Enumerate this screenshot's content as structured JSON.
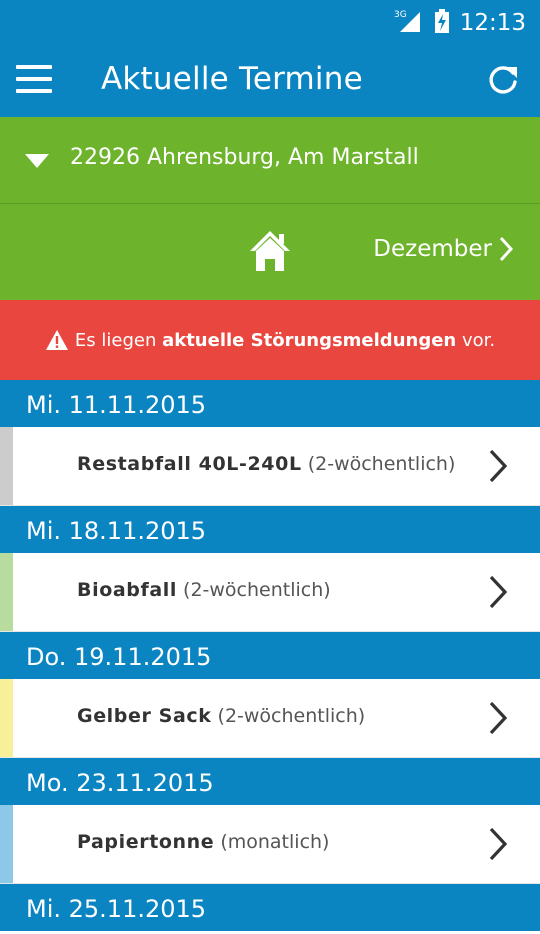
{
  "status": {
    "network": "3G",
    "time": "12:13"
  },
  "appbar": {
    "title": "Aktuelle Termine",
    "menu_icon": "menu-icon",
    "refresh_icon": "refresh-icon"
  },
  "address": {
    "text": "22926 Ahrensburg, Am Marstall"
  },
  "month_nav": {
    "next_label": "Dezember"
  },
  "alert": {
    "prefix": "Es liegen ",
    "bold": "aktuelle Störungsmeldungen",
    "suffix": " vor."
  },
  "colors": {
    "primary": "#0a85c2",
    "green": "#6db32b",
    "alert": "#e8463e"
  },
  "entries": [
    {
      "date": "Mi. 11.11.2015",
      "name": "Restabfall 40L-240L",
      "freq": "(2-wöchentlich)",
      "color": "#cccccc"
    },
    {
      "date": "Mi. 18.11.2015",
      "name": "Bioabfall",
      "freq": "(2-wöchentlich)",
      "color": "#b8dc9e"
    },
    {
      "date": "Do. 19.11.2015",
      "name": "Gelber Sack",
      "freq": "(2-wöchentlich)",
      "color": "#f7ef9a"
    },
    {
      "date": "Mo. 23.11.2015",
      "name": "Papiertonne",
      "freq": "(monatlich)",
      "color": "#8ec8e8"
    },
    {
      "date": "Mi. 25.11.2015"
    }
  ]
}
